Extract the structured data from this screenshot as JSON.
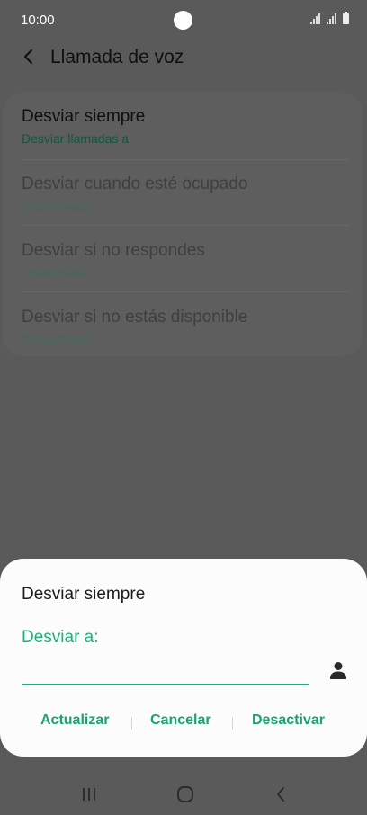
{
  "status_bar": {
    "time": "10:00",
    "icons": [
      "wifi-signal-icon",
      "cell-signal-icon",
      "battery-icon"
    ]
  },
  "header": {
    "back_icon": "chevron-left-icon",
    "title": "Llamada de voz"
  },
  "forwarding_options": [
    {
      "title": "Desviar siempre",
      "subtitle": "Desviar llamadas a"
    },
    {
      "title": "Desviar cuando esté ocupado",
      "subtitle": "Desactivado"
    },
    {
      "title": "Desviar si no respondes",
      "subtitle": "Desactivado"
    },
    {
      "title": "Desviar si no estás disponible",
      "subtitle": "Desactivado"
    }
  ],
  "dialog": {
    "title": "Desviar siempre",
    "field_label": "Desviar a:",
    "field_value": "",
    "contact_icon": "person-icon",
    "actions": {
      "update": "Actualizar",
      "cancel": "Cancelar",
      "deactivate": "Desactivar"
    }
  },
  "navigation_bar": {
    "icons": [
      "recent-apps-icon",
      "home-icon",
      "back-icon"
    ]
  },
  "colors": {
    "accent": "#1db07a",
    "dim_background": "#5a5a5a",
    "dialog_background": "#fcfcfc"
  }
}
